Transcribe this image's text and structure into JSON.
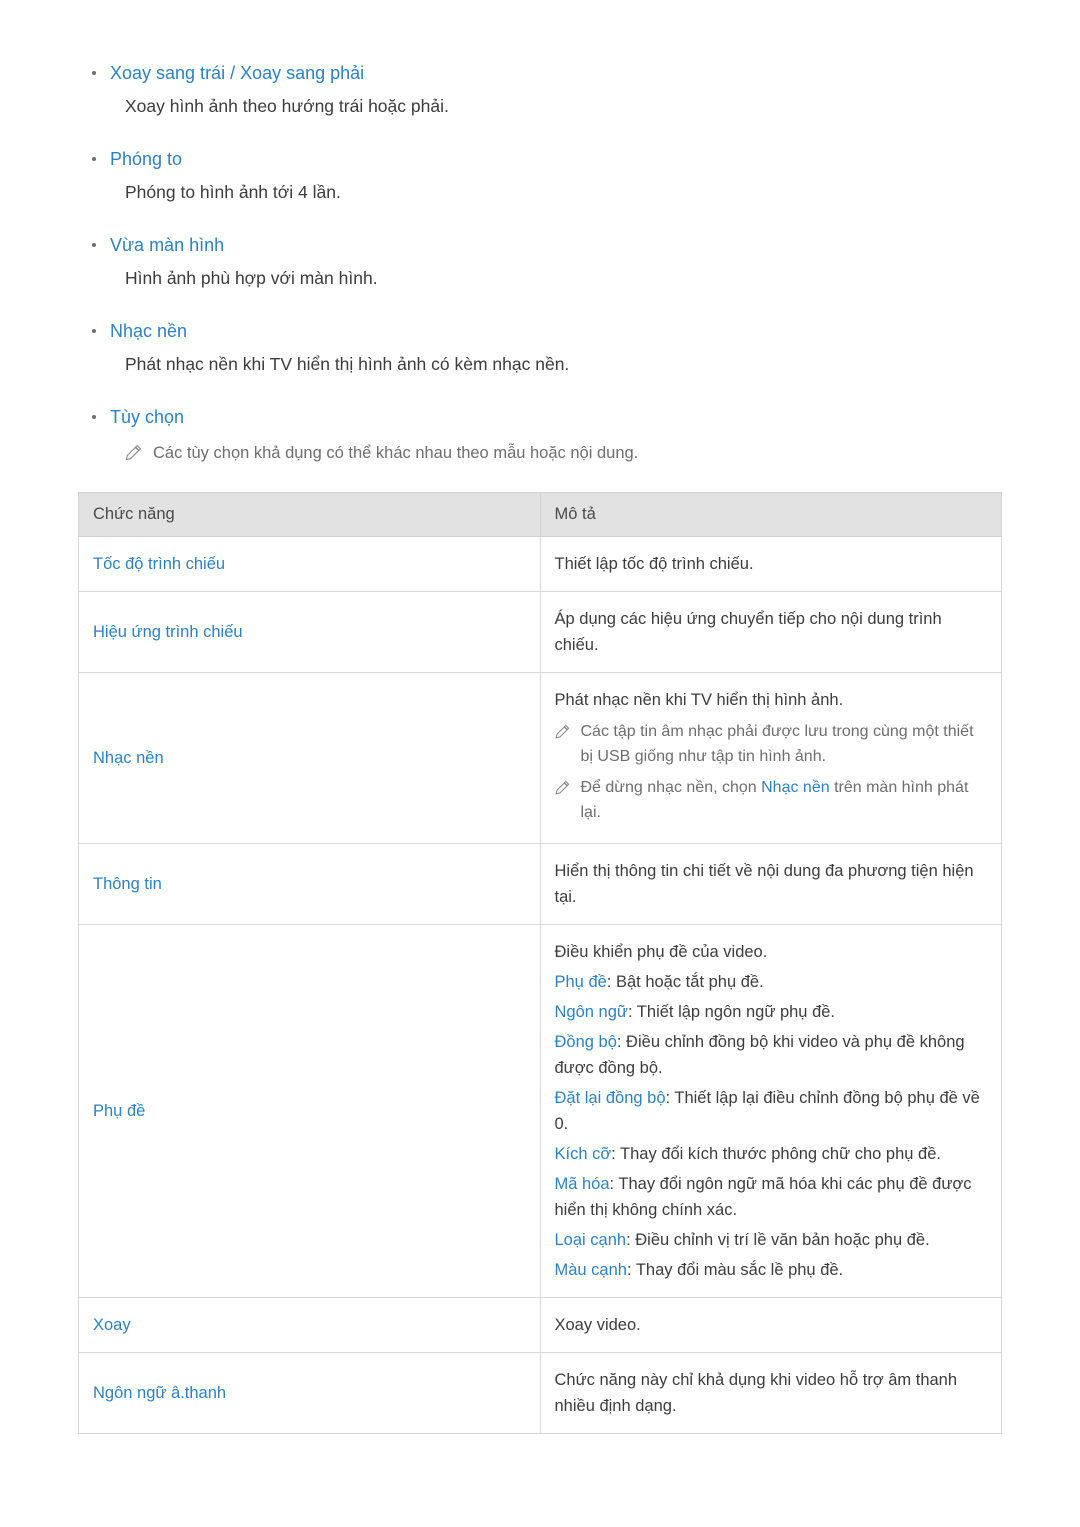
{
  "sections": [
    {
      "title": "Xoay sang trái / Xoay sang phải",
      "body": "Xoay hình ảnh theo hướng trái hoặc phải."
    },
    {
      "title": "Phóng to",
      "body": "Phóng to hình ảnh tới 4 lần."
    },
    {
      "title": "Vừa màn hình",
      "body": "Hình ảnh phù hợp với màn hình."
    },
    {
      "title": "Nhạc nền",
      "body": "Phát nhạc nền khi TV hiển thị hình ảnh có kèm nhạc nền."
    },
    {
      "title": "Tùy chọn",
      "note": "Các tùy chọn khả dụng có thể khác nhau theo mẫu hoặc nội dung."
    }
  ],
  "table": {
    "headers": [
      "Chức năng",
      "Mô tả"
    ],
    "rows": [
      {
        "fn": "Tốc độ trình chiếu",
        "desc": "Thiết lập tốc độ trình chiếu."
      },
      {
        "fn": "Hiệu ứng trình chiếu",
        "desc": "Áp dụng các hiệu ứng chuyển tiếp cho nội dung trình chiếu."
      },
      {
        "fn": "Nhạc nền",
        "desc_line1": "Phát nhạc nền khi TV hiển thị hình ảnh.",
        "note1": "Các tập tin âm nhạc phải được lưu trong cùng một thiết bị USB giống như tập tin hình ảnh.",
        "note2_pre": "Để dừng nhạc nền, chọn ",
        "note2_kw": "Nhạc nền",
        "note2_post": " trên màn hình phát lại."
      },
      {
        "fn": "Thông tin",
        "desc": "Hiển thị thông tin chi tiết về nội dung đa phương tiện hiện tại."
      },
      {
        "fn": "Phụ đề",
        "desc_line1": "Điều khiển phụ đề của video.",
        "items": [
          {
            "kw": "Phụ đề",
            "text": ": Bật hoặc tắt phụ đề."
          },
          {
            "kw": "Ngôn ngữ",
            "text": ": Thiết lập ngôn ngữ phụ đề."
          },
          {
            "kw": "Đồng bộ",
            "text": ": Điều chỉnh đồng bộ khi video và phụ đề không được đồng bộ."
          },
          {
            "kw": "Đặt lại đồng bộ",
            "text": ": Thiết lập lại điều chỉnh đồng bộ phụ đề về 0."
          },
          {
            "kw": "Kích cỡ",
            "text": ": Thay đổi kích thước phông chữ cho phụ đề."
          },
          {
            "kw": "Mã hóa",
            "text": ": Thay đổi ngôn ngữ mã hóa khi các phụ đề được hiển thị không chính xác."
          },
          {
            "kw": "Loại cạnh",
            "text": ": Điều chỉnh vị trí lề văn bản hoặc phụ đề."
          },
          {
            "kw": "Màu cạnh",
            "text": ": Thay đổi màu sắc lề phụ đề."
          }
        ]
      },
      {
        "fn": "Xoay",
        "desc": "Xoay video."
      },
      {
        "fn": "Ngôn ngữ â.thanh",
        "desc": "Chức năng này chỉ khả dụng khi video hỗ trợ âm thanh nhiều định dạng."
      }
    ]
  },
  "icons": {
    "pencil": "pencil-icon"
  },
  "colors": {
    "accent": "#2f7fc1",
    "text": "#3c3c3c",
    "note": "#6d6d6d",
    "header_bg": "#e2e2e2"
  }
}
